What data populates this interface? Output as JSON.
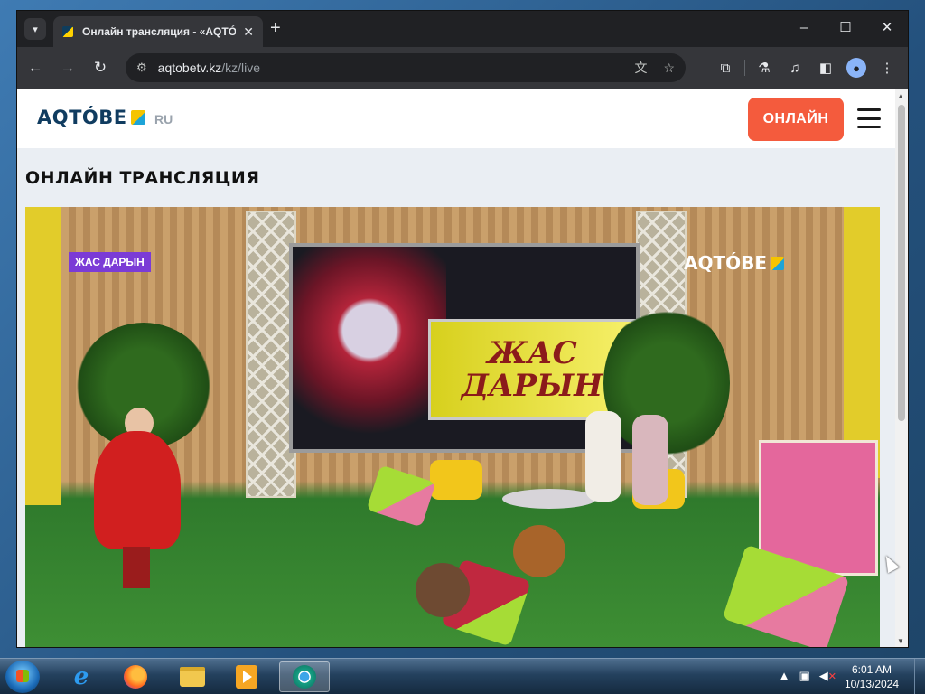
{
  "browser": {
    "tab_title": "Онлайн трансляция - «AQTÓ",
    "tab_close": "✕",
    "new_tab": "+",
    "url_domain": "aqtobetv.kz",
    "url_path": "/kz/live",
    "window_controls": [
      "–",
      "☐",
      "✕"
    ]
  },
  "site": {
    "logo": "AQTÓBE",
    "lang": "RU",
    "live_button": "ОНЛАЙН",
    "page_title": "ОНЛАЙН ТРАНСЛЯЦИЯ"
  },
  "player": {
    "badge": "ЖАС ДАРЫН",
    "watermark": "AQTÓBE",
    "sign_line1": "ЖАС",
    "sign_line2": "ДАРЫН"
  },
  "taskbar": {
    "time": "6:01 AM",
    "date": "10/13/2024",
    "tray_up": "▲"
  },
  "colors": {
    "live_button": "#f45b3d",
    "logo_text": "#103c60",
    "badge": "#7b3bd6",
    "chrome_bg": "#202124"
  },
  "icons": [
    "back-arrow-icon",
    "forward-arrow-icon",
    "reload-icon",
    "site-info-icon",
    "translate-icon",
    "star-icon",
    "extensions-icon",
    "lab-icon",
    "media-control-icon",
    "side-panel-icon",
    "profile-icon",
    "menu-dots-icon",
    "hamburger-icon"
  ]
}
